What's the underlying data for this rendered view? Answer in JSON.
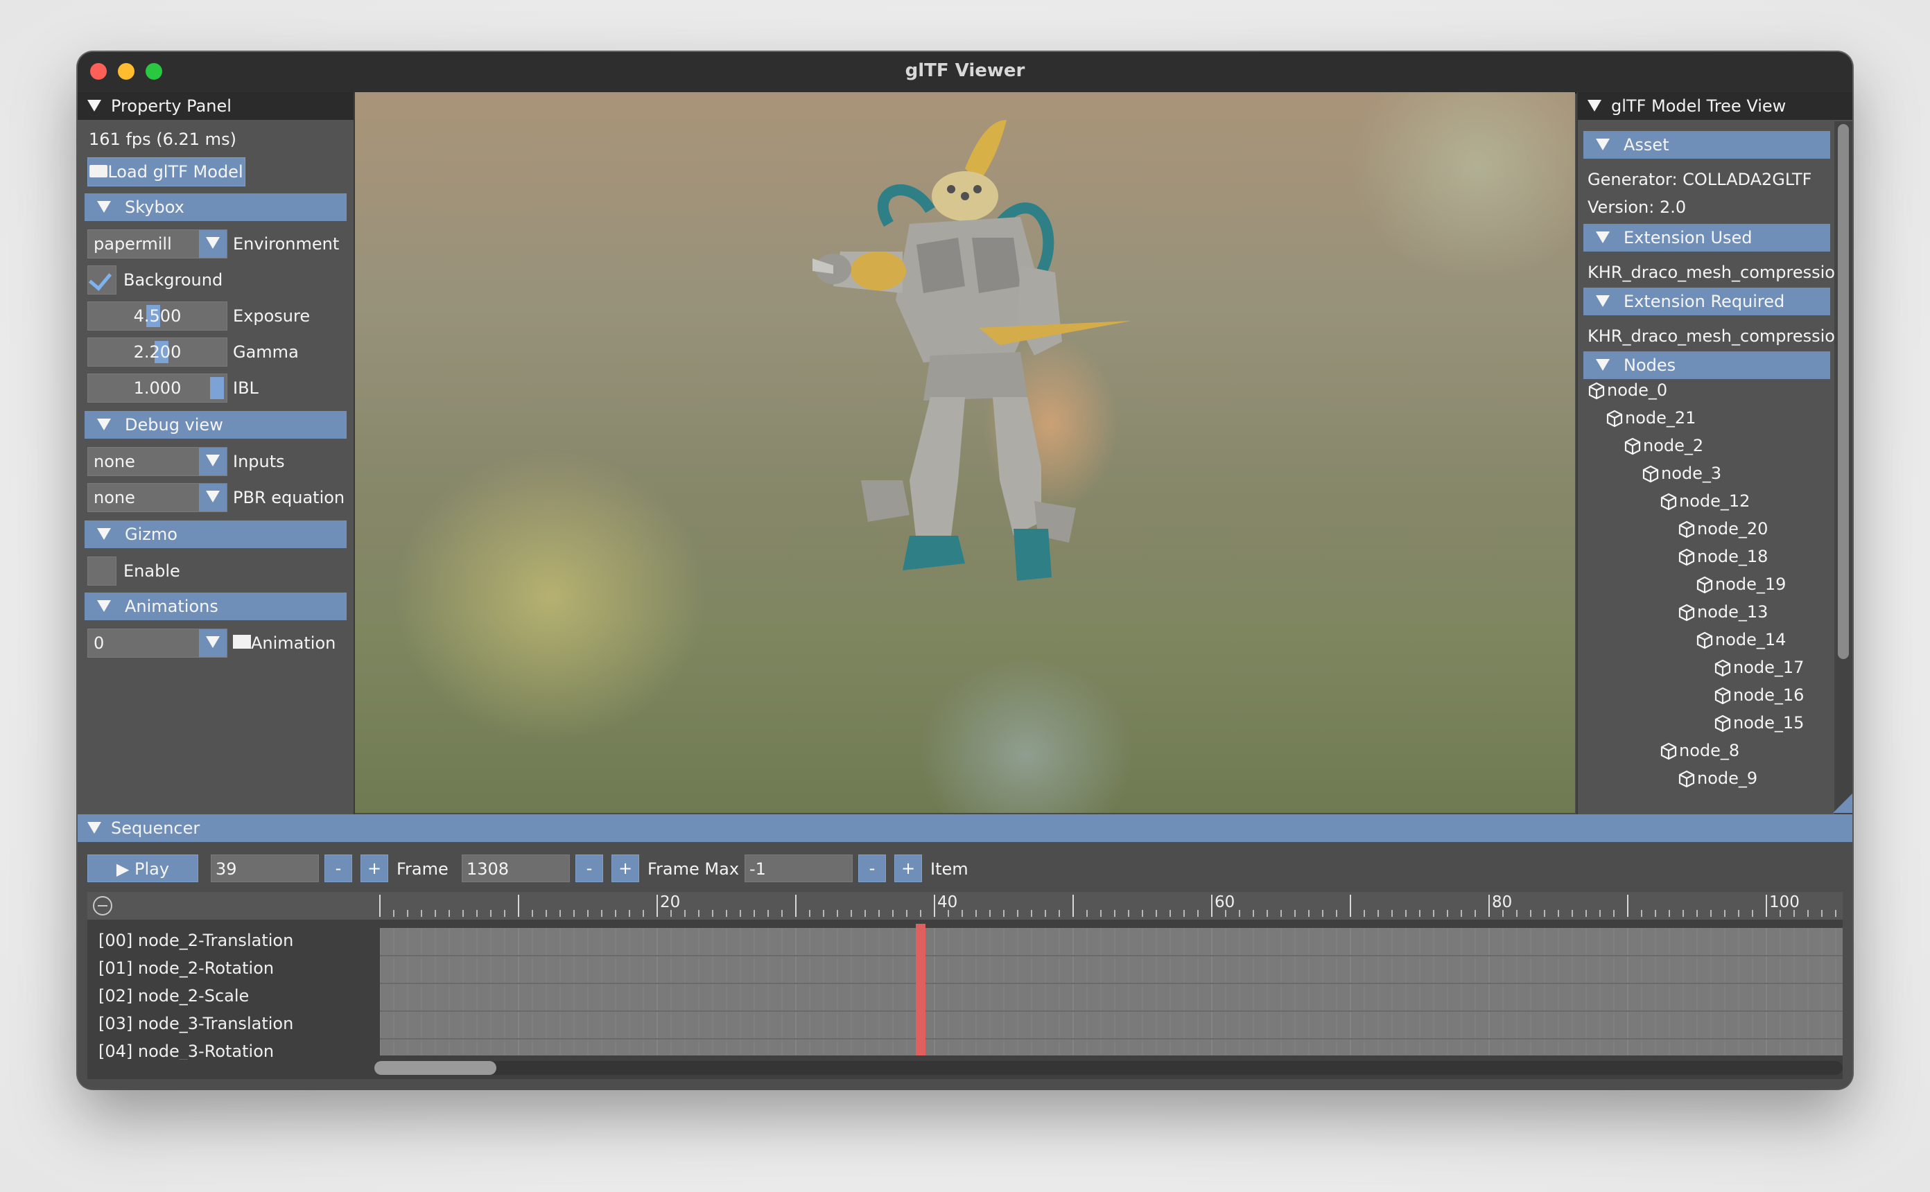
{
  "window": {
    "title": "glTF Viewer"
  },
  "property_panel": {
    "title": "Property Panel",
    "fps": "161 fps (6.21 ms)",
    "load_button": "Load glTF Model",
    "skybox": {
      "title": "Skybox",
      "environment_value": "papermill",
      "environment_label": "Environment",
      "background_label": "Background",
      "background_checked": true,
      "exposure_value": "4.500",
      "exposure_label": "Exposure",
      "gamma_value": "2.200",
      "gamma_label": "Gamma",
      "ibl_value": "1.000",
      "ibl_label": "IBL"
    },
    "debug_view": {
      "title": "Debug view",
      "inputs_value": "none",
      "inputs_label": "Inputs",
      "pbr_value": "none",
      "pbr_label": "PBR equation"
    },
    "gizmo": {
      "title": "Gizmo",
      "enable_label": "Enable",
      "enable_checked": false
    },
    "animations": {
      "title": "Animations",
      "value": "0",
      "label": "Animation"
    }
  },
  "tree_view": {
    "title": "glTF Model Tree View",
    "asset_title": "Asset",
    "generator": "Generator: COLLADA2GLTF",
    "version": "Version: 2.0",
    "ext_used_title": "Extension Used",
    "ext_used": "KHR_draco_mesh_compression",
    "ext_required_title": "Extension Required",
    "ext_required": "KHR_draco_mesh_compression",
    "nodes_title": "Nodes",
    "nodes": [
      {
        "name": "node_0",
        "depth": 0
      },
      {
        "name": "node_21",
        "depth": 1
      },
      {
        "name": "node_2",
        "depth": 2
      },
      {
        "name": "node_3",
        "depth": 3
      },
      {
        "name": "node_12",
        "depth": 4
      },
      {
        "name": "node_20",
        "depth": 5
      },
      {
        "name": "node_18",
        "depth": 5
      },
      {
        "name": "node_19",
        "depth": 6
      },
      {
        "name": "node_13",
        "depth": 5
      },
      {
        "name": "node_14",
        "depth": 6
      },
      {
        "name": "node_17",
        "depth": 7
      },
      {
        "name": "node_16",
        "depth": 7
      },
      {
        "name": "node_15",
        "depth": 7
      },
      {
        "name": "node_8",
        "depth": 4
      },
      {
        "name": "node_9",
        "depth": 5
      }
    ]
  },
  "sequencer": {
    "title": "Sequencer",
    "play_label": "▶ Play",
    "current_frame": "39",
    "minus": "-",
    "plus": "+",
    "frame_label": "Frame",
    "frame_max_value": "1308",
    "frame_max_label": "Frame Max",
    "item_value": "-1",
    "item_label": "Item",
    "ruler_labels": [
      "20",
      "40",
      "60",
      "80",
      "100"
    ],
    "playhead_frame": 39,
    "tracks": [
      "[00] node_2-Translation",
      "[01] node_2-Rotation",
      "[02] node_2-Scale",
      "[03] node_3-Translation",
      "[04] node_3-Rotation"
    ]
  },
  "colors": {
    "accent": "#6f8fb8",
    "playhead": "#e06060",
    "panel_bg": "#535353"
  }
}
